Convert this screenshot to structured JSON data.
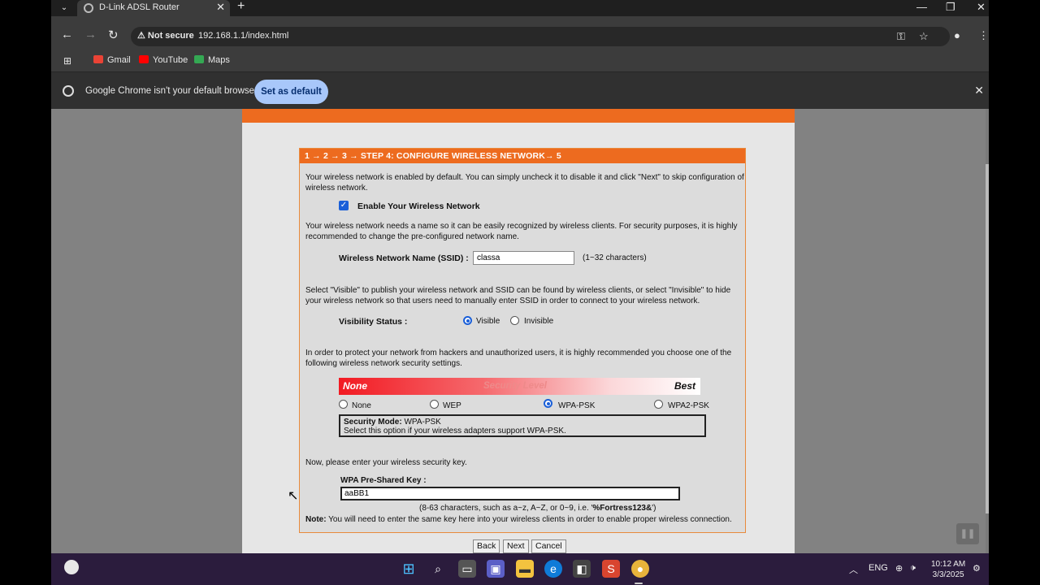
{
  "browser": {
    "tab_title": "D-Link ADSL Router",
    "security_warning": "Not secure",
    "url": "192.168.1.1/index.html",
    "bookmarks": [
      {
        "label": "Gmail",
        "icon": "gmail-icon",
        "color": "#ea4335"
      },
      {
        "label": "YouTube",
        "icon": "youtube-icon",
        "color": "#ff0000"
      },
      {
        "label": "Maps",
        "icon": "maps-icon",
        "color": "#34a853"
      }
    ],
    "infobar": {
      "message": "Google Chrome isn't your default browser",
      "button": "Set as default"
    }
  },
  "wizard": {
    "header": "1 → 2 → 3 → STEP 4: CONFIGURE WIRELESS NETWORK→ 5",
    "intro": "Your wireless network is enabled by default. You can simply uncheck it to disable it and click \"Next\" to skip configuration of wireless network.",
    "enable_label": "Enable Your Wireless Network",
    "enable_checked": true,
    "ssid_intro": "Your wireless network needs a name so it can be easily recognized by wireless clients. For security purposes, it is highly recommended to change the pre-configured network name.",
    "ssid_label": "Wireless Network Name (SSID) :",
    "ssid_value": "classa",
    "ssid_hint": "(1~32 characters)",
    "visibility_intro": "Select \"Visible\" to publish your wireless network and SSID can be found by wireless clients, or select \"Invisible\" to hide your wireless network so that users need to manually enter SSID in order to connect to your wireless network.",
    "visibility_label": "Visibility Status :",
    "visibility_options": [
      "Visible",
      "Invisible"
    ],
    "visibility_selected": "Visible",
    "security_intro": "In order to protect your network from hackers and unauthorized users, it is highly recommended you choose one of the following wireless network security settings.",
    "security_bar": {
      "low": "None",
      "middle": "Security Level",
      "high": "Best"
    },
    "security_options": [
      "None",
      "WEP",
      "WPA-PSK",
      "WPA2-PSK"
    ],
    "security_selected": "WPA-PSK",
    "security_mode_label": "Security Mode:",
    "security_mode_value": "WPA-PSK",
    "security_mode_desc": "Select this option if your wireless adapters support WPA-PSK.",
    "key_intro": "Now, please enter your wireless security key.",
    "key_label": "WPA Pre-Shared Key :",
    "key_value": "aaBB1",
    "key_hint_prefix": "(8-63 characters, such as a~z, A~Z, or 0~9, i.e. '",
    "key_hint_example": "%Fortress123&",
    "key_hint_suffix": "')",
    "note_label": "Note:",
    "note_text": "You will need to enter the same key here into your wireless clients in order to enable proper wireless connection.",
    "buttons": {
      "back": "Back",
      "next": "Next",
      "cancel": "Cancel"
    }
  },
  "taskbar": {
    "language": "ENG",
    "time": "10:12 AM",
    "date": "3/3/2025"
  }
}
